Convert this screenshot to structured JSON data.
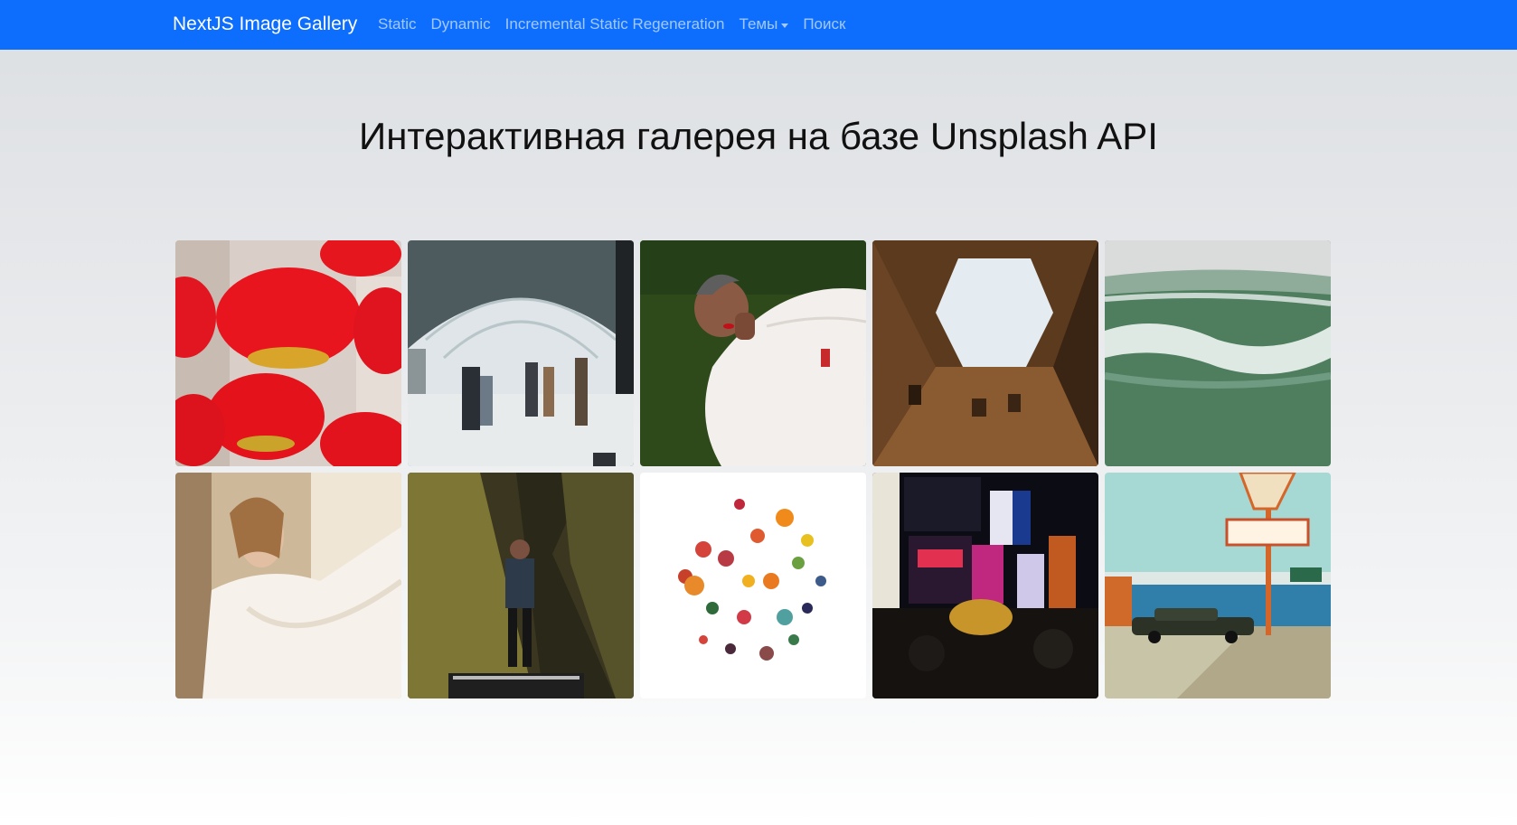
{
  "navbar": {
    "brand": "NextJS Image Gallery",
    "links": [
      {
        "label": "Static"
      },
      {
        "label": "Dynamic"
      },
      {
        "label": "Incremental Static Regeneration"
      },
      {
        "label": "Темы",
        "dropdown": true
      },
      {
        "label": "Поиск"
      }
    ],
    "color": "#0d6efd"
  },
  "main": {
    "title": "Интерактивная галерея на базе Unsplash API"
  },
  "gallery": {
    "images": [
      {
        "subject": "red-lanterns"
      },
      {
        "subject": "train-station"
      },
      {
        "subject": "woman-on-grass"
      },
      {
        "subject": "courtyard-sky"
      },
      {
        "subject": "ocean-waves"
      },
      {
        "subject": "woman-window-curtain"
      },
      {
        "subject": "man-on-mountain"
      },
      {
        "subject": "flower-circle"
      },
      {
        "subject": "city-night-billboards"
      },
      {
        "subject": "retro-motel-car"
      }
    ]
  }
}
